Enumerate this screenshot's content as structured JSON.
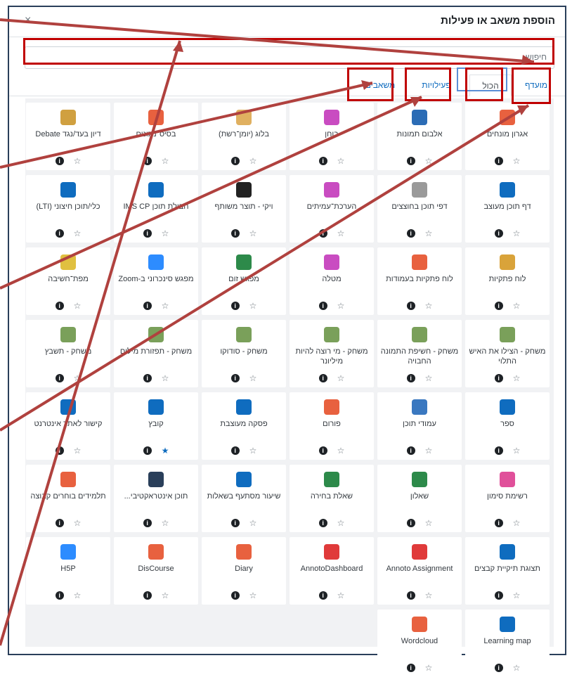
{
  "dialog": {
    "title": "הוספת משאב או פעילות",
    "close": "×"
  },
  "search": {
    "placeholder": "חיפוש"
  },
  "tabs": {
    "favourites": "מועדף",
    "all": "הכול",
    "activities": "פעילויות",
    "resources": "משאבים"
  },
  "items": [
    {
      "name": "אגרון מונחים",
      "color": "#e8613f",
      "icon": "glossary-icon",
      "starred": false
    },
    {
      "name": "אלבום תמונות",
      "color": "#2b6cb5",
      "icon": "album-icon",
      "starred": false
    },
    {
      "name": "בוחן",
      "color": "#c94cc1",
      "icon": "quiz-icon",
      "starred": false
    },
    {
      "name": "בלוג (יומן־רשת)",
      "color": "#e0b060",
      "icon": "blog-icon",
      "starred": false
    },
    {
      "name": "בסיס־נתונים",
      "color": "#e8613f",
      "icon": "database-icon",
      "starred": false
    },
    {
      "name": "דיון בעד/נגד Debate",
      "color": "#d0a040",
      "icon": "debate-icon",
      "starred": false
    },
    {
      "name": "דף תוכן מעוצב",
      "color": "#0f6cbf",
      "icon": "page-icon",
      "starred": false
    },
    {
      "name": "דפי תוכן בחוצצים",
      "color": "#9a9a9a",
      "icon": "tabs-icon",
      "starred": false
    },
    {
      "name": "הערכת־עמיתים",
      "color": "#c94cc1",
      "icon": "workshop-icon",
      "starred": false
    },
    {
      "name": "ויקי - תוצר משותף",
      "color": "#222222",
      "icon": "wiki-icon",
      "starred": false
    },
    {
      "name": "חבילת תוכן IMS CP",
      "color": "#0f6cbf",
      "icon": "ims-icon",
      "starred": false
    },
    {
      "name": "כלי/תוכן חיצוני (LTI)",
      "color": "#0f6cbf",
      "icon": "lti-icon",
      "starred": false
    },
    {
      "name": "לוח פתקיות",
      "color": "#d9a33a",
      "icon": "padlet-icon",
      "starred": false
    },
    {
      "name": "לוח פתקיות בעמודות",
      "color": "#e8613f",
      "icon": "columns-icon",
      "starred": false
    },
    {
      "name": "מטלה",
      "color": "#c94cc1",
      "icon": "assignment-icon",
      "starred": false
    },
    {
      "name": "מפגש זום",
      "color": "#2d8a4a",
      "icon": "zoom-meeting-icon",
      "starred": false
    },
    {
      "name": "מפגש סינכרוני ב-Zoom",
      "color": "#2d8cff",
      "icon": "zoom-icon",
      "starred": false
    },
    {
      "name": "מפת־חשיבה",
      "color": "#e0c040",
      "icon": "mindmap-icon",
      "starred": false
    },
    {
      "name": "משחק - הצילו את האיש התלוי",
      "color": "#7aa05a",
      "icon": "game-icon",
      "starred": false
    },
    {
      "name": "משחק - חשיפת התמונה החבויה",
      "color": "#7aa05a",
      "icon": "game-icon",
      "starred": false
    },
    {
      "name": "משחק - מי רוצה להיות מיליונר",
      "color": "#7aa05a",
      "icon": "game-icon",
      "starred": false
    },
    {
      "name": "משחק - סודוקו",
      "color": "#7aa05a",
      "icon": "game-icon",
      "starred": false
    },
    {
      "name": "משחק - תפזורת מילים",
      "color": "#7aa05a",
      "icon": "game-icon",
      "starred": false
    },
    {
      "name": "משחק - תשבץ",
      "color": "#7aa05a",
      "icon": "game-icon",
      "starred": false
    },
    {
      "name": "ספר",
      "color": "#0f6cbf",
      "icon": "book-icon",
      "starred": false
    },
    {
      "name": "עמודי תוכן",
      "color": "#3a78c0",
      "icon": "lesson-icon",
      "starred": false
    },
    {
      "name": "פורום",
      "color": "#e8613f",
      "icon": "forum-icon",
      "starred": false
    },
    {
      "name": "פסקה מעוצבת",
      "color": "#0f6cbf",
      "icon": "label-icon",
      "starred": false
    },
    {
      "name": "קובץ",
      "color": "#0f6cbf",
      "icon": "file-icon",
      "starred": true
    },
    {
      "name": "קישור לאתר אינטרנט",
      "color": "#0f6cbf",
      "icon": "url-icon",
      "starred": false
    },
    {
      "name": "רשימת סימון",
      "color": "#e0509a",
      "icon": "checklist-icon",
      "starred": false
    },
    {
      "name": "שאלון",
      "color": "#2d8a4a",
      "icon": "questionnaire-icon",
      "starred": false
    },
    {
      "name": "שאלת בחירה",
      "color": "#2d8a4a",
      "icon": "choice-icon",
      "starred": false
    },
    {
      "name": "שיעור מסתעף בשאלות",
      "color": "#0f6cbf",
      "icon": "branching-icon",
      "starred": false
    },
    {
      "name": "תוכן אינטראקטיבי...",
      "color": "#2a3f5a",
      "icon": "h5p-icon",
      "starred": false
    },
    {
      "name": "תלמידים בוחרים קבוצה",
      "color": "#e8613f",
      "icon": "group-icon",
      "starred": false
    },
    {
      "name": "תצוגת תיקיית קבצים",
      "color": "#0f6cbf",
      "icon": "folder-icon",
      "starred": false
    },
    {
      "name": "Annoto Assignment",
      "color": "#e03a3a",
      "icon": "annoto-icon",
      "starred": false
    },
    {
      "name": "AnnotoDashboard",
      "color": "#e03a3a",
      "icon": "annoto-dashboard-icon",
      "starred": false
    },
    {
      "name": "Diary",
      "color": "#e8613f",
      "icon": "diary-icon",
      "starred": false
    },
    {
      "name": "DisCourse",
      "color": "#e8613f",
      "icon": "discourse-icon",
      "starred": false
    },
    {
      "name": "H5P",
      "color": "#2d8cff",
      "icon": "h5p-icon",
      "starred": false
    },
    {
      "name": "Learning map",
      "color": "#0f6cbf",
      "icon": "learning-map-icon",
      "starred": false
    },
    {
      "name": "Wordcloud",
      "color": "#e8613f",
      "icon": "wordcloud-icon",
      "starred": false
    }
  ],
  "glyphs": {
    "info": "i",
    "star_empty": "☆",
    "star_full": "★"
  }
}
